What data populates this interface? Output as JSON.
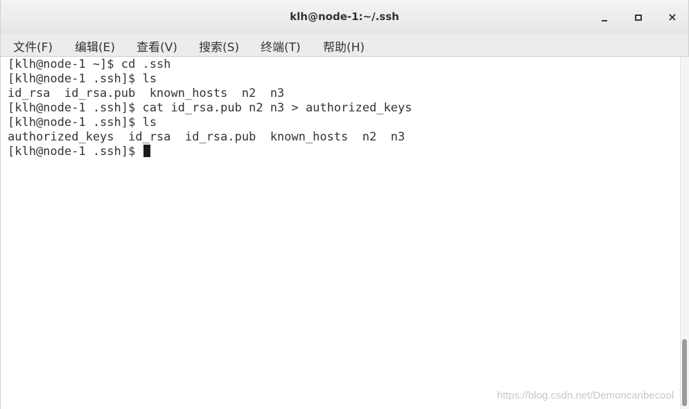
{
  "window": {
    "title": "klh@node-1:~/.ssh",
    "controls": {
      "minimize_icon": "minimize-icon",
      "maximize_icon": "maximize-icon",
      "close_glyph": "×"
    }
  },
  "menu": {
    "items": [
      {
        "label": "文件(F)"
      },
      {
        "label": "编辑(E)"
      },
      {
        "label": "查看(V)"
      },
      {
        "label": "搜索(S)"
      },
      {
        "label": "终端(T)"
      },
      {
        "label": "帮助(H)"
      }
    ]
  },
  "terminal": {
    "lines": [
      "[klh@node-1 ~]$ cd .ssh",
      "[klh@node-1 .ssh]$ ls",
      "id_rsa  id_rsa.pub  known_hosts  n2  n3",
      "[klh@node-1 .ssh]$ cat id_rsa.pub n2 n3 > authorized_keys",
      "[klh@node-1 .ssh]$ ls",
      "authorized_keys  id_rsa  id_rsa.pub  known_hosts  n2  n3",
      "[klh@node-1 .ssh]$ "
    ]
  },
  "watermark": "https://blog.csdn.net/Demoncanbecool",
  "colors": {
    "text": "#2e3436",
    "background": "#ffffff",
    "titlebar": "#e6e6e6"
  }
}
